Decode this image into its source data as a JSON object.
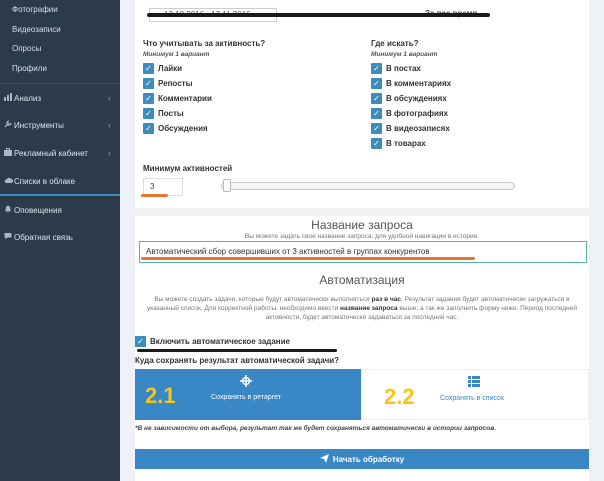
{
  "sidebar": {
    "sub_items": [
      "Фотографии",
      "Видеозаписи",
      "Опросы",
      "Профили"
    ],
    "main_items": [
      {
        "label": "Анализ",
        "icon": "chart-icon",
        "has_children": true
      },
      {
        "label": "Инструменты",
        "icon": "wrench-icon",
        "has_children": true
      },
      {
        "label": "Рекламный кабинет",
        "icon": "briefcase-icon",
        "has_children": true
      },
      {
        "label": "Списки в облаке",
        "icon": "cloud-icon",
        "has_children": false
      },
      {
        "label": "Оповещения",
        "icon": "bell-icon",
        "has_children": false
      },
      {
        "label": "Обратная связь",
        "icon": "chat-icon",
        "has_children": false
      }
    ]
  },
  "top": {
    "date_range": "12.10.2016 - 17.11.2016",
    "all_time_label": "За все время"
  },
  "activity": {
    "title": "Что учитывать за активность?",
    "subtitle": "Минимум 1 вариант",
    "options": [
      "Лайки",
      "Репосты",
      "Комментарии",
      "Посты",
      "Обсуждения"
    ]
  },
  "where": {
    "title": "Где искать?",
    "subtitle": "Минимум 1 вариант",
    "options": [
      "В постах",
      "В комментариях",
      "В обсуждениях",
      "В фотографиях",
      "В видеозаписях",
      "В товарах"
    ]
  },
  "min_activity": {
    "label": "Минимум активностей",
    "value": "3",
    "slider_fraction": 0.02
  },
  "query_name": {
    "title": "Название запроса",
    "note": "Вы можете задать свое название запроса, для удобной навигации в истории.",
    "value": "Автоматический сбор совершивших от 3 активностей в группах конкурентов"
  },
  "automation": {
    "title": "Автоматизация",
    "note_part1": "Вы можете создать задачи, которые будут автоматически выполняться",
    "note_bold1": "раз в час",
    "note_part2": ". Результат задания будет автоматически загружаться в указанный список. Для корректной работы, необходимо ввести",
    "note_bold2": "название запроса",
    "note_part3": "выше, а так же заполнить форму ниже. Период последней активности, будет автоматически задаваться за последний час.",
    "enable_label": "Включить автоматическое задание",
    "where_label": "Куда сохранять результат автоматической задачи?",
    "options": [
      {
        "num": "2.1",
        "label": "Сохранять в ретаргет",
        "icon": "crosshair-icon"
      },
      {
        "num": "2.2",
        "label": "Сохранять в список",
        "icon": "list-icon"
      }
    ],
    "footnote": "*В не зависимости от выбора, результат так же будет сохраняться автоматически в истории запросов."
  },
  "start_button": "Начать обработку",
  "colors": {
    "sidebar_bg": "#2c3b49",
    "accent": "#3a87c6",
    "highlight_number": "#f5c518",
    "annotation_orange": "#e8772e"
  }
}
